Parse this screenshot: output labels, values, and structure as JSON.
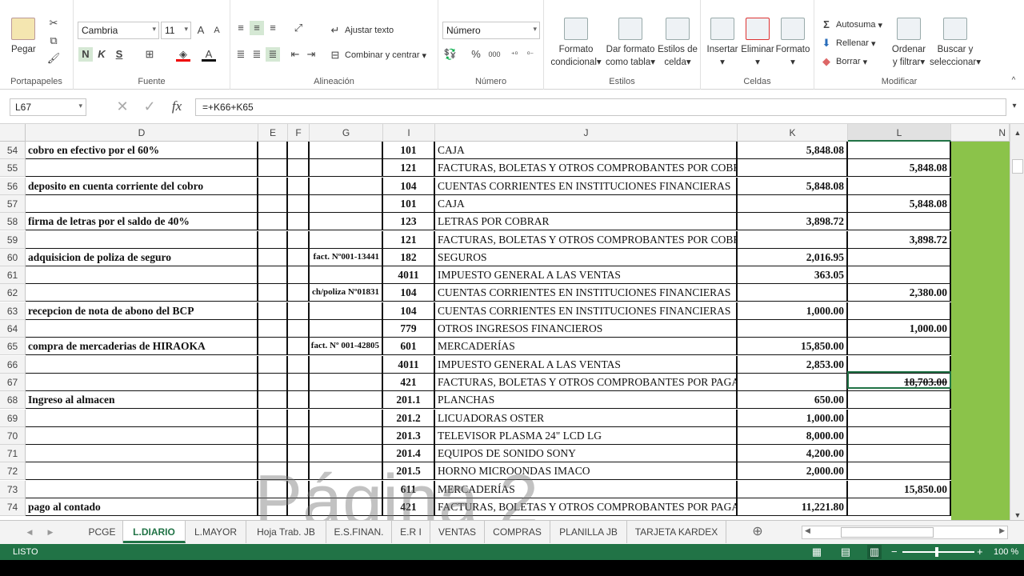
{
  "ribbon": {
    "portapapeles": {
      "pegar": "Pegar",
      "label": "Portapapeles"
    },
    "fuente": {
      "font_name": "Cambria",
      "font_size": "11",
      "bold": "N",
      "italic": "K",
      "underline": "S",
      "label": "Fuente"
    },
    "alineacion": {
      "ajustar": "Ajustar texto",
      "combinar": "Combinar y centrar",
      "label": "Alineación"
    },
    "numero": {
      "format": "Número",
      "percent": "%",
      "thousands": "000",
      "label": "Número"
    },
    "estilos": {
      "formato_condicional": [
        "Formato",
        "condicional"
      ],
      "dar_formato": [
        "Dar formato",
        "como tabla"
      ],
      "estilos_celda": [
        "Estilos de",
        "celda"
      ],
      "label": "Estilos"
    },
    "celdas": {
      "insertar": "Insertar",
      "eliminar": "Eliminar",
      "formato": "Formato",
      "label": "Celdas"
    },
    "modificar": {
      "autosuma": "Autosuma",
      "rellenar": "Rellenar",
      "borrar": "Borrar",
      "ordenar": [
        "Ordenar",
        "y filtrar"
      ],
      "buscar": [
        "Buscar y",
        "seleccionar"
      ],
      "label": "Modificar"
    }
  },
  "formula_bar": {
    "name_box": "L67",
    "formula": "=+K66+K65"
  },
  "columns": [
    "D",
    "E",
    "F",
    "G",
    "I",
    "J",
    "K",
    "L",
    "N"
  ],
  "rows": [
    {
      "n": "54",
      "d": "cobro en efectivo por el 60%",
      "g": "",
      "i": "101",
      "j": "CAJA",
      "k": "5,848.08",
      "l": ""
    },
    {
      "n": "55",
      "d": "",
      "g": "",
      "i": "121",
      "j": "FACTURAS, BOLETAS Y OTROS COMPROBANTES POR COBRAR",
      "k": "",
      "l": "5,848.08"
    },
    {
      "n": "56",
      "d": "deposito en cuenta corriente del cobro",
      "g": "",
      "i": "104",
      "j": "CUENTAS CORRIENTES EN INSTITUCIONES FINANCIERAS",
      "k": "5,848.08",
      "l": ""
    },
    {
      "n": "57",
      "d": "",
      "g": "",
      "i": "101",
      "j": "CAJA",
      "k": "",
      "l": "5,848.08"
    },
    {
      "n": "58",
      "d": "firma de letras por el saldo de 40%",
      "g": "",
      "i": "123",
      "j": "LETRAS POR COBRAR",
      "k": "3,898.72",
      "l": ""
    },
    {
      "n": "59",
      "d": "",
      "g": "",
      "i": "121",
      "j": "FACTURAS, BOLETAS Y OTROS COMPROBANTES POR COBRAR",
      "k": "",
      "l": "3,898.72"
    },
    {
      "n": "60",
      "d": "adquisicion de poliza de seguro",
      "g": "fact. Nº001-13441",
      "i": "182",
      "j": "SEGUROS",
      "k": "2,016.95",
      "l": ""
    },
    {
      "n": "61",
      "d": "",
      "g": "",
      "i": "4011",
      "j": "IMPUESTO GENERAL A LAS VENTAS",
      "k": "363.05",
      "l": ""
    },
    {
      "n": "62",
      "d": "",
      "g": "ch/poliza Nº01831",
      "i": "104",
      "j": "CUENTAS CORRIENTES EN INSTITUCIONES FINANCIERAS",
      "k": "",
      "l": "2,380.00"
    },
    {
      "n": "63",
      "d": "recepcion de nota de abono del BCP",
      "g": "",
      "i": "104",
      "j": "CUENTAS CORRIENTES EN INSTITUCIONES FINANCIERAS",
      "k": "1,000.00",
      "l": ""
    },
    {
      "n": "64",
      "d": "",
      "g": "",
      "i": "779",
      "j": "OTROS INGRESOS FINANCIEROS",
      "k": "",
      "l": "1,000.00"
    },
    {
      "n": "65",
      "d": "compra de mercaderias de HIRAOKA",
      "g": "fact. Nº 001-42805",
      "i": "601",
      "j": "MERCADERÍAS",
      "k": "15,850.00",
      "l": ""
    },
    {
      "n": "66",
      "d": "",
      "g": "",
      "i": "4011",
      "j": "IMPUESTO GENERAL A LAS VENTAS",
      "k": "2,853.00",
      "l": ""
    },
    {
      "n": "67",
      "d": "",
      "g": "",
      "i": "421",
      "j": "FACTURAS, BOLETAS Y OTROS COMPROBANTES POR PAGAR",
      "k": "",
      "l": "18,703.00"
    },
    {
      "n": "68",
      "d": "Ingreso al almacen",
      "g": "",
      "i": "201.1",
      "j": "PLANCHAS",
      "k": "650.00",
      "l": ""
    },
    {
      "n": "69",
      "d": "",
      "g": "",
      "i": "201.2",
      "j": "LICUADORAS OSTER",
      "k": "1,000.00",
      "l": ""
    },
    {
      "n": "70",
      "d": "",
      "g": "",
      "i": "201.3",
      "j": "TELEVISOR PLASMA 24\" LCD LG",
      "k": "8,000.00",
      "l": ""
    },
    {
      "n": "71",
      "d": "",
      "g": "",
      "i": "201.4",
      "j": "EQUIPOS DE SONIDO SONY",
      "k": "4,200.00",
      "l": ""
    },
    {
      "n": "72",
      "d": "",
      "g": "",
      "i": "201.5",
      "j": "HORNO MICROONDAS IMACO",
      "k": "2,000.00",
      "l": ""
    },
    {
      "n": "73",
      "d": "",
      "g": "",
      "i": "611",
      "j": "MERCADERÍAS",
      "k": "",
      "l": "15,850.00"
    },
    {
      "n": "74",
      "d": "pago al contado",
      "g": "",
      "i": "421",
      "j": "FACTURAS, BOLETAS Y OTROS COMPROBANTES POR PAGAR",
      "k": "11,221.80",
      "l": ""
    }
  ],
  "watermark": "Página 2",
  "sheet_tabs": [
    "PCGE",
    "L.DIARIO",
    "L.MAYOR",
    "Hoja Trab. JB",
    "E.S.FINAN.",
    "E.R I",
    "VENTAS",
    "COMPRAS",
    "PLANILLA JB",
    "TARJETA KARDEX"
  ],
  "active_tab": "L.DIARIO",
  "status": {
    "mode": "LISTO",
    "zoom": "100 %"
  }
}
